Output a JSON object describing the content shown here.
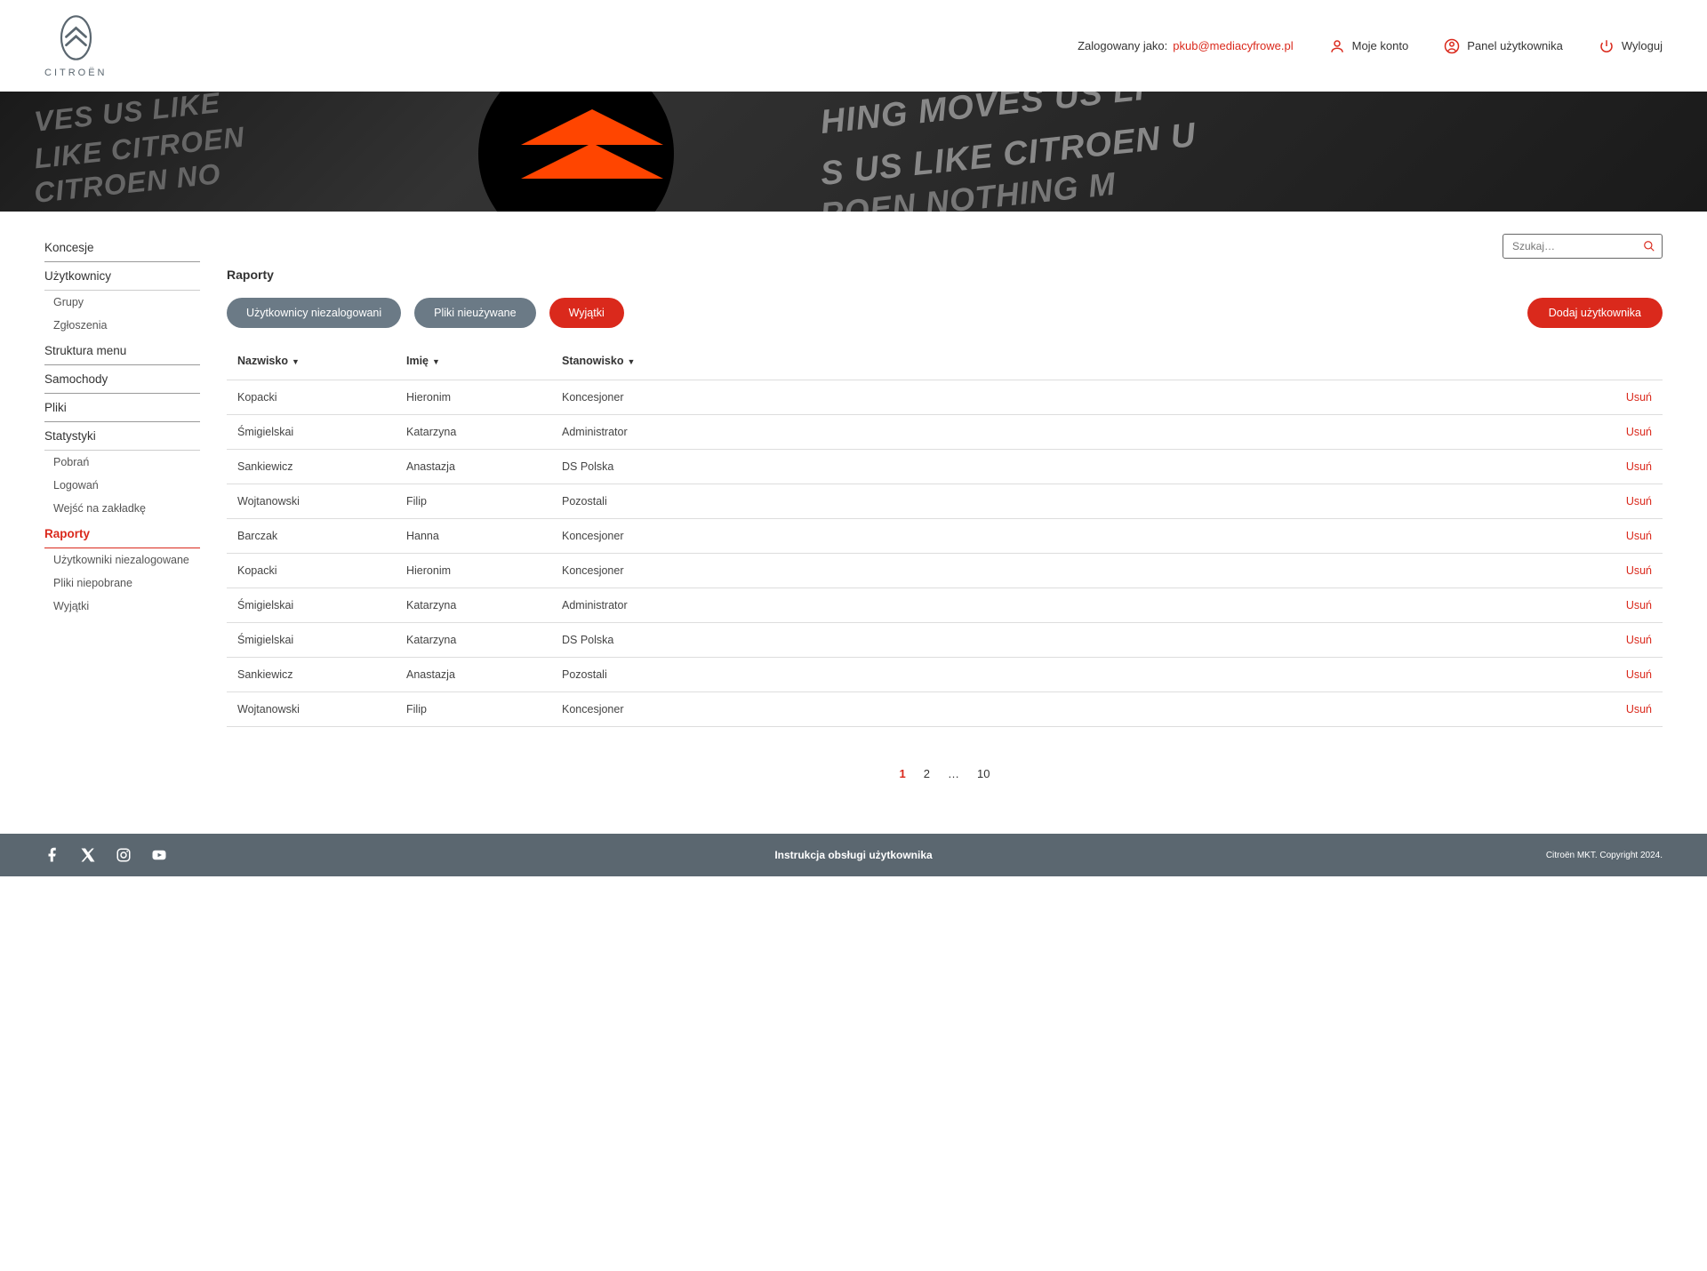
{
  "header": {
    "brand": "CITROËN",
    "logged_label": "Zalogowany jako:",
    "logged_email": "pkub@mediacyfrowe.pl",
    "my_account": "Moje konto",
    "user_panel": "Panel użytkownika",
    "logout": "Wyloguj"
  },
  "sidebar": {
    "koncesje": "Koncesje",
    "uzytkownicy": "Użytkownicy",
    "grupy": "Grupy",
    "zgloszenia": "Zgłoszenia",
    "struktura": "Struktura menu",
    "samochody": "Samochody",
    "pliki": "Pliki",
    "statystyki": "Statystyki",
    "pobran": "Pobrań",
    "logowan": "Logowań",
    "wejsc": "Wejść na zakładkę",
    "raporty": "Raporty",
    "uzyt_niezal": "Użytkowniki niezalogowane",
    "pliki_niepobrane": "Pliki niepobrane",
    "wyjatki": "Wyjątki"
  },
  "search": {
    "placeholder": "Szukaj…"
  },
  "page": {
    "title": "Raporty",
    "tab1": "Użytkownicy niezalogowani",
    "tab2": "Pliki nieużywane",
    "tab3": "Wyjątki",
    "add_btn": "Dodaj użytkownika"
  },
  "table": {
    "head": {
      "last": "Nazwisko",
      "first": "Imię",
      "role": "Stanowisko"
    },
    "delete": "Usuń",
    "rows": [
      {
        "last": "Kopacki",
        "first": "Hieronim",
        "role": "Koncesjoner"
      },
      {
        "last": "Śmigielskai",
        "first": "Katarzyna",
        "role": "Administrator"
      },
      {
        "last": "Sankiewicz",
        "first": "Anastazja",
        "role": "DS Polska"
      },
      {
        "last": "Wojtanowski",
        "first": "Filip",
        "role": "Pozostali"
      },
      {
        "last": "Barczak",
        "first": "Hanna",
        "role": "Koncesjoner"
      },
      {
        "last": "Kopacki",
        "first": "Hieronim",
        "role": "Koncesjoner"
      },
      {
        "last": "Śmigielskai",
        "first": "Katarzyna",
        "role": "Administrator"
      },
      {
        "last": "Śmigielskai",
        "first": "Katarzyna",
        "role": "DS Polska"
      },
      {
        "last": "Sankiewicz",
        "first": "Anastazja",
        "role": "Pozostali"
      },
      {
        "last": "Wojtanowski",
        "first": "Filip",
        "role": "Koncesjoner"
      }
    ]
  },
  "pagination": {
    "p1": "1",
    "p2": "2",
    "dots": "…",
    "last": "10"
  },
  "footer": {
    "manual": "Instrukcja obsługi użytkownika",
    "copy": "Citroën MKT. Copyright 2024."
  }
}
